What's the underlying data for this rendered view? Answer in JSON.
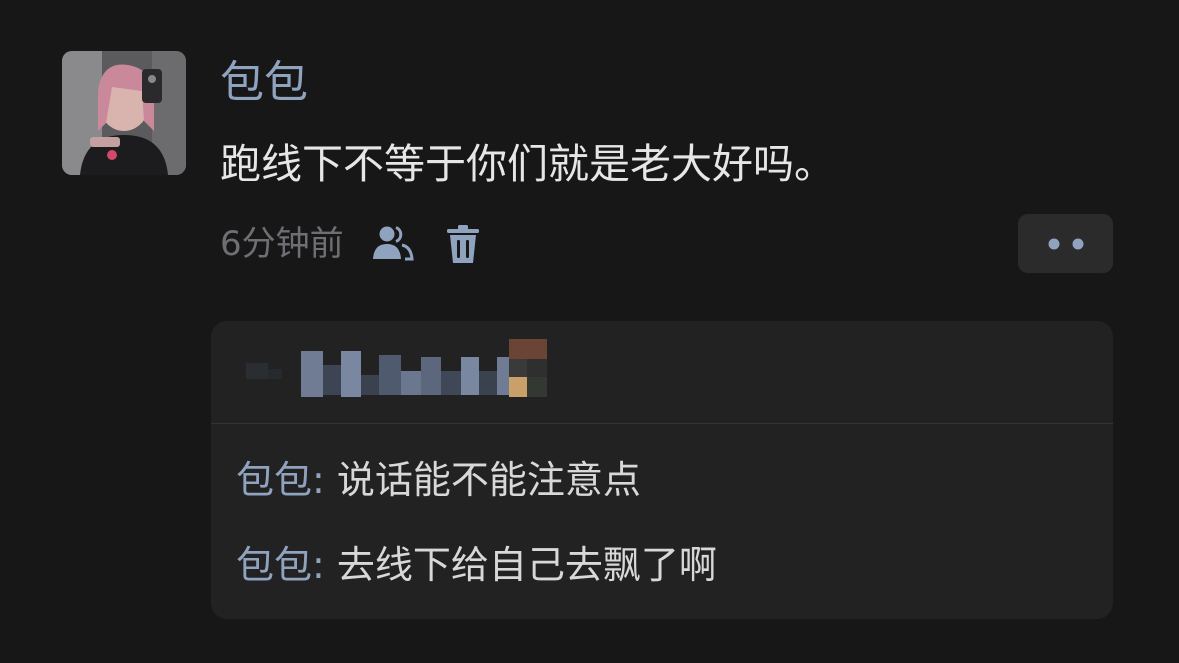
{
  "post": {
    "author": "包包",
    "content": "跑线下不等于你们就是老大好吗。",
    "timestamp": "6分钟前",
    "icons": {
      "avatar": "user-avatar-photo",
      "visibility": "people-icon",
      "delete": "trash-icon",
      "more": "more-dots-icon"
    }
  },
  "replies_panel": {
    "header_obscured": true,
    "replies": [
      {
        "author": "包包",
        "separator": ":",
        "text": "说话能不能注意点"
      },
      {
        "author": "包包",
        "separator": ":",
        "text": "去线下给自己去飘了啊"
      }
    ]
  },
  "colors": {
    "background": "#171717",
    "panel": "#222223",
    "accent_name": "#8fa3bf",
    "text": "#e6e6e6",
    "muted": "#6f6f73",
    "icon": "#8fa3bf"
  }
}
